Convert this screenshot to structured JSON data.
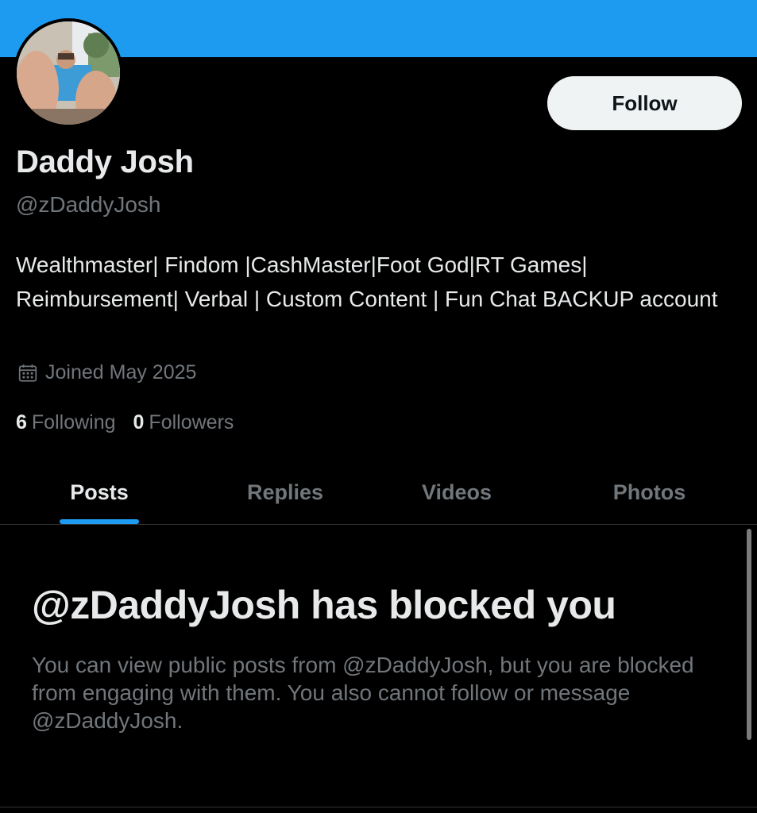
{
  "profile": {
    "display_name": "Daddy Josh",
    "handle": "@zDaddyJosh",
    "bio": "Wealthmaster| Findom |CashMaster|Foot God|RT Games| Reimbursement| Verbal | Custom Content | Fun Chat BACKUP account",
    "joined": "Joined May 2025",
    "avatar_icon": "profile-photo",
    "calendar_icon": "calendar-icon"
  },
  "actions": {
    "follow_label": "Follow"
  },
  "stats": {
    "following_count": "6",
    "following_label": "Following",
    "followers_count": "0",
    "followers_label": "Followers"
  },
  "tabs": [
    {
      "label": "Posts",
      "active": true
    },
    {
      "label": "Replies",
      "active": false
    },
    {
      "label": "Videos",
      "active": false
    },
    {
      "label": "Photos",
      "active": false
    }
  ],
  "blocked": {
    "title": "@zDaddyJosh has blocked you",
    "description": "You can view public posts from @zDaddyJosh, but you are blocked from engaging with them. You also cannot follow or message @zDaddyJosh."
  },
  "colors": {
    "accent": "#1d9bf0",
    "background": "#000000",
    "primary_text": "#e7e9ea",
    "secondary_text": "#71767b"
  }
}
